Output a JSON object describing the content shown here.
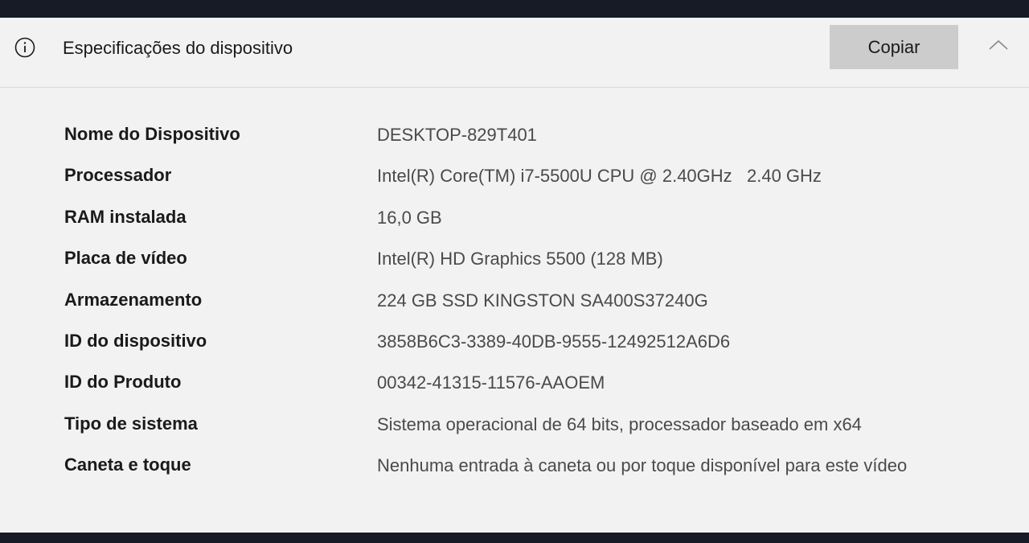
{
  "header": {
    "title": "Especificações do dispositivo",
    "copy_label": "Copiar",
    "info_icon": "info-icon",
    "collapse_icon": "chevron-up-icon"
  },
  "specs": [
    {
      "label": "Nome do Dispositivo",
      "value": "DESKTOP-829T401"
    },
    {
      "label": "Processador",
      "value": "Intel(R) Core(TM) i7-5500U CPU @ 2.40GHz   2.40 GHz"
    },
    {
      "label": "RAM instalada",
      "value": "16,0 GB"
    },
    {
      "label": "Placa de vídeo",
      "value": "Intel(R) HD Graphics 5500 (128 MB)"
    },
    {
      "label": "Armazenamento",
      "value": "224 GB SSD KINGSTON SA400S37240G"
    },
    {
      "label": "ID do dispositivo",
      "value": "3858B6C3-3389-40DB-9555-12492512A6D6"
    },
    {
      "label": "ID do Produto",
      "value": "00342-41315-11576-AAOEM"
    },
    {
      "label": "Tipo de sistema",
      "value": "Sistema operacional de 64 bits, processador baseado em x64"
    },
    {
      "label": "Caneta e toque",
      "value": "Nenhuma entrada à caneta ou por toque disponível para este vídeo"
    }
  ]
}
